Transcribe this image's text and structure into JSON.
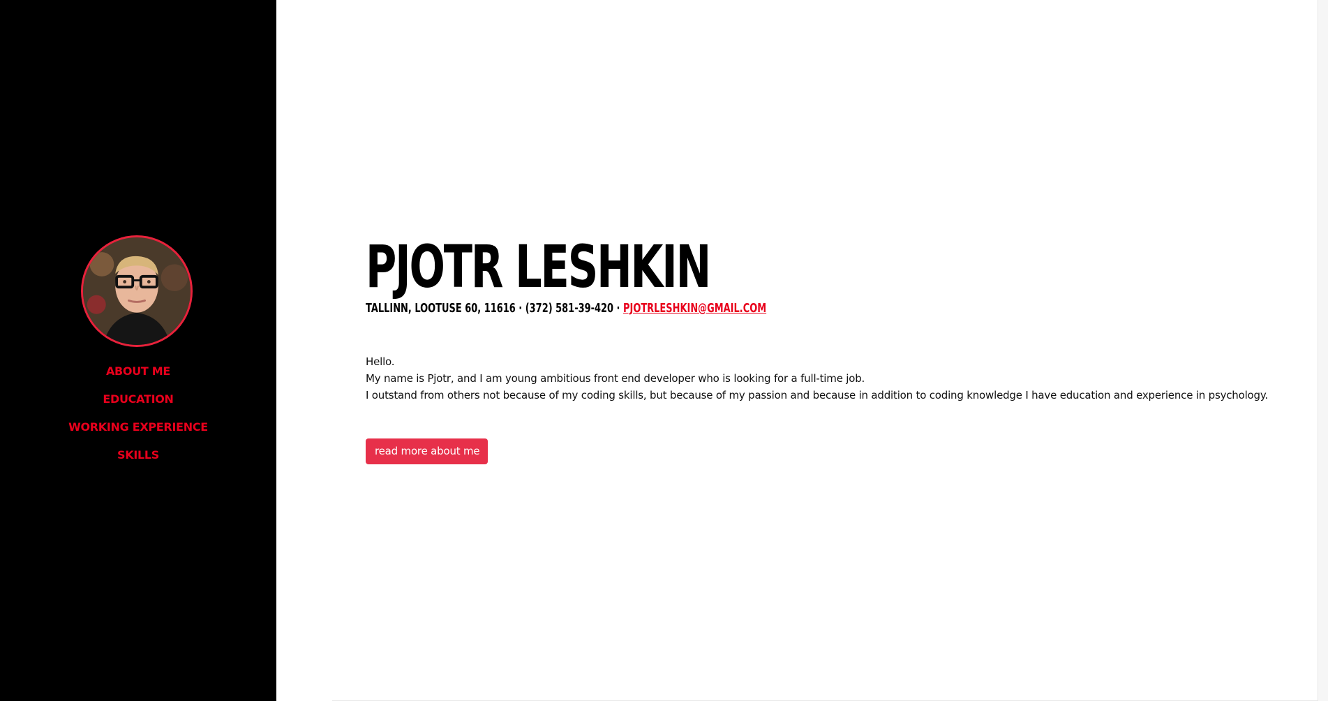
{
  "sidebar": {
    "avatar_alt": "Profile photo",
    "nav": [
      {
        "label": "ABOUT ME"
      },
      {
        "label": "EDUCATION"
      },
      {
        "label": "WORKING EXPERIENCE"
      },
      {
        "label": "SKILLS"
      }
    ]
  },
  "profile": {
    "name": "PJOTR LESHKIN",
    "address": "TALLINN, LOOTUSE 60, 11616",
    "separator": " · ",
    "phone": "(372) 581-39-420",
    "email": "PJOTRLESHKIN@GMAIL.COM"
  },
  "intro": {
    "lines": [
      "Hello.",
      "My name is Pjotr, and I am young ambitious front end developer who is looking for a full-time job.",
      "I outstand from others not because of my coding skills, but because of my passion and because in addition to coding knowledge I have education and experience in psychology."
    ]
  },
  "cta": {
    "label": "read more about me"
  },
  "colors": {
    "sidebar_bg": "#000000",
    "accent": "#e8001c",
    "button_bg": "#e7304a"
  }
}
